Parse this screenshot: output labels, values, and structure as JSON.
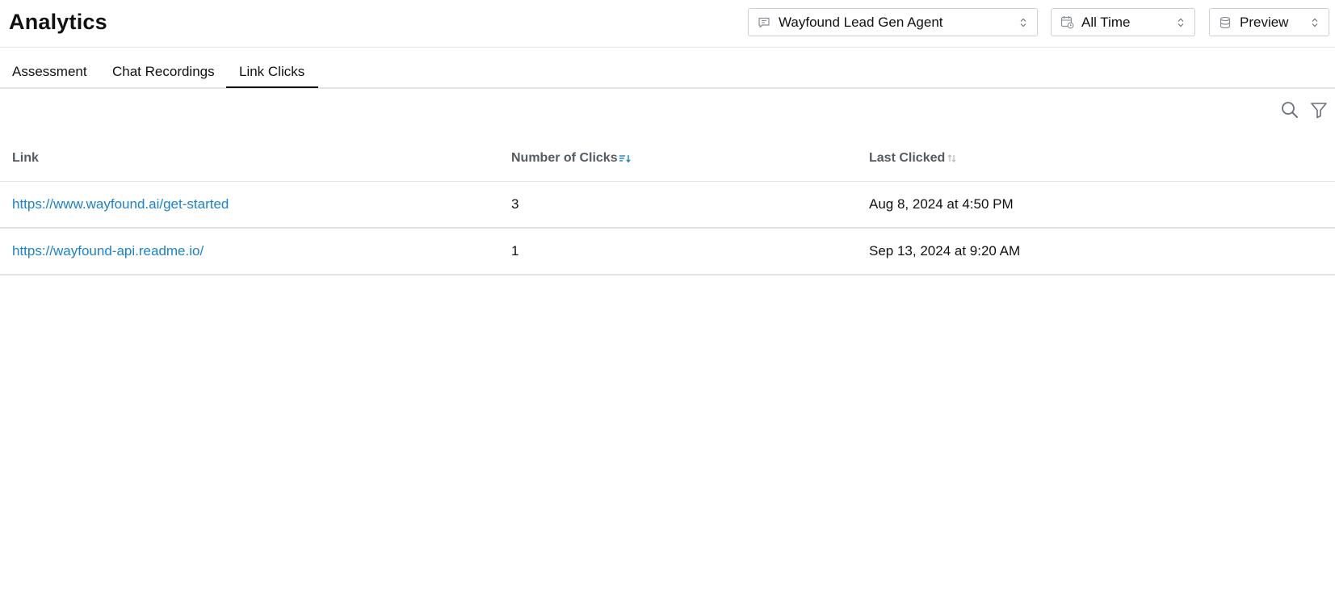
{
  "header": {
    "title": "Analytics"
  },
  "filters": {
    "agent": {
      "value": "Wayfound Lead Gen Agent",
      "icon": "chat-bubble-icon"
    },
    "time_range": {
      "value": "All Time",
      "icon": "calendar-icon"
    },
    "environment": {
      "value": "Preview",
      "icon": "database-icon"
    }
  },
  "tabs": [
    {
      "label": "Assessment",
      "active": false
    },
    {
      "label": "Chat Recordings",
      "active": false
    },
    {
      "label": "Link Clicks",
      "active": true
    }
  ],
  "toolbar": {
    "search_icon": "search-icon",
    "filter_icon": "filter-icon"
  },
  "table": {
    "columns": [
      {
        "label": "Link",
        "sort": "none"
      },
      {
        "label": "Number of Clicks",
        "sort": "descending-active"
      },
      {
        "label": "Last Clicked",
        "sort": "sortable"
      }
    ],
    "rows": [
      {
        "link": "https://www.wayfound.ai/get-started",
        "clicks": "3",
        "last_clicked": "Aug 8, 2024 at 4:50 PM"
      },
      {
        "link": "https://wayfound-api.readme.io/",
        "clicks": "1",
        "last_clicked": "Sep 13, 2024 at 9:20 AM"
      }
    ]
  },
  "colors": {
    "link": "#1a83cc",
    "accent_sort": "#1a83cc",
    "border": "#e3e3e3",
    "text": "#111111"
  }
}
